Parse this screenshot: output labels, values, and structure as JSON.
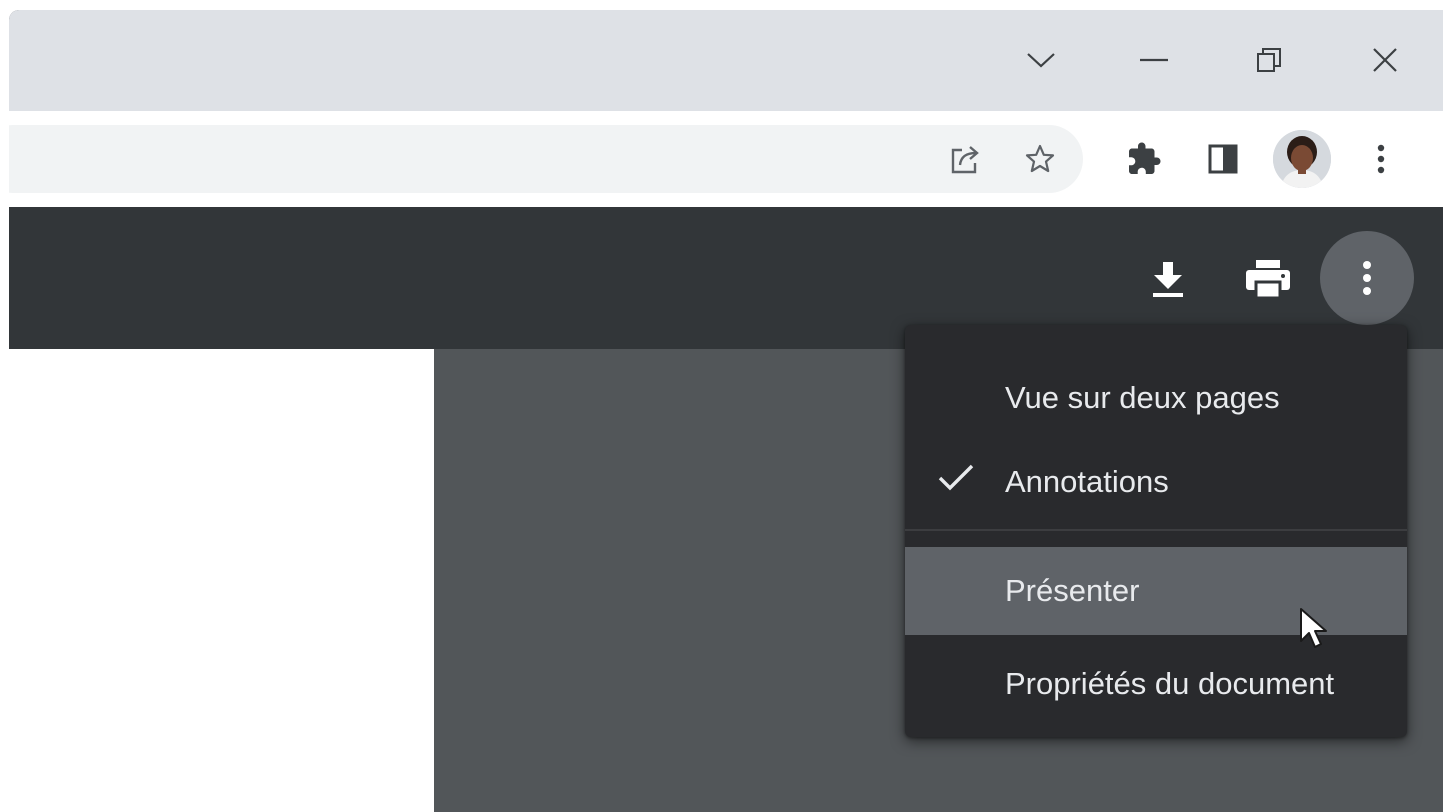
{
  "window_controls": {
    "tab_search": "tab-search",
    "minimize": "minimize",
    "restore": "restore",
    "close": "close"
  },
  "toolbar": {
    "icons": [
      "share-icon",
      "bookmark-star-icon",
      "extensions-puzzle-icon",
      "side-panel-icon",
      "profile-avatar",
      "chrome-menu-icon"
    ]
  },
  "pdf_toolbar": {
    "icons": [
      "download-icon",
      "print-icon",
      "more-options-icon"
    ]
  },
  "menu": {
    "items": [
      {
        "label": "Vue sur deux pages",
        "checked": false
      },
      {
        "label": "Annotations",
        "checked": true
      },
      {
        "label": "Présenter",
        "hovered": true
      },
      {
        "label": "Propriétés du document"
      }
    ]
  },
  "colors": {
    "titlebar": "#dee1e6",
    "pdf_toolbar": "#323639",
    "pdf_background": "#525659",
    "menu_background": "#292a2d",
    "menu_hover": "#5f6368",
    "menu_text": "#e8eaed"
  }
}
